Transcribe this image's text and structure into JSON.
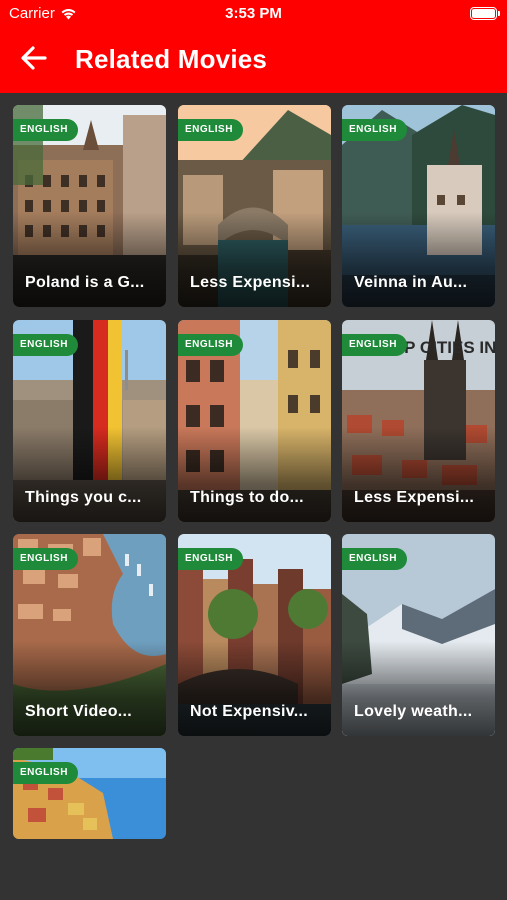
{
  "status": {
    "carrier": "Carrier",
    "time": "3:53 PM"
  },
  "header": {
    "title": "Related Movies",
    "back_icon": "arrow-left-icon"
  },
  "colors": {
    "header": "#ff0000",
    "background": "#333333",
    "badge": "#1f8a3a"
  },
  "movies": [
    {
      "badge": "ENGLISH",
      "title": "Poland is a G..."
    },
    {
      "badge": "ENGLISH",
      "title": "Less Expensi..."
    },
    {
      "badge": "ENGLISH",
      "title": "Veinna in Au..."
    },
    {
      "badge": "ENGLISH",
      "title": "Things you c..."
    },
    {
      "badge": "ENGLISH",
      "title": "Things to do..."
    },
    {
      "badge": "ENGLISH",
      "title": "Less Expensi...",
      "thumb_text": "CHEAP CITIES IN EUROPE"
    },
    {
      "badge": "ENGLISH",
      "title": "Short Video..."
    },
    {
      "badge": "ENGLISH",
      "title": "Not Expensiv..."
    },
    {
      "badge": "ENGLISH",
      "title": "Lovely weath..."
    },
    {
      "badge": "ENGLISH",
      "title": ""
    }
  ]
}
